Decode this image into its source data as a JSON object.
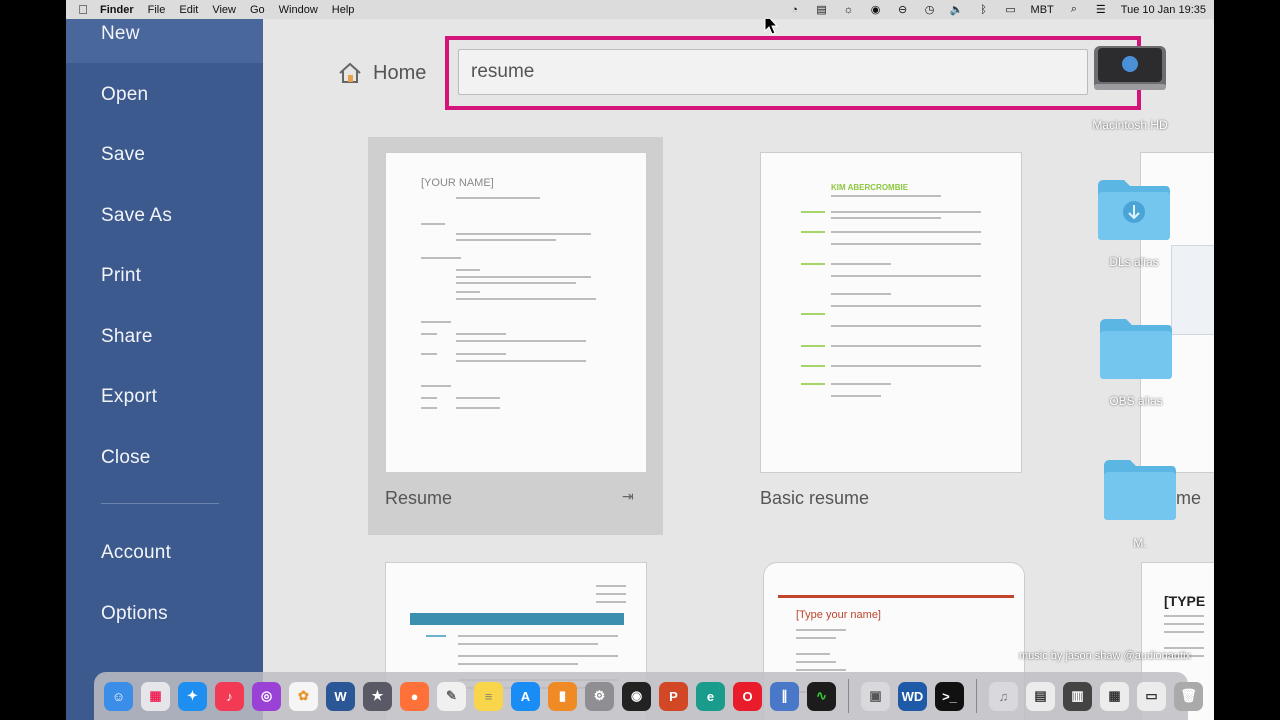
{
  "menubar": {
    "app": "Finder",
    "items": [
      "File",
      "Edit",
      "View",
      "Go",
      "Window",
      "Help"
    ],
    "status": "MBT",
    "datetime": "Tue 10 Jan  19:35"
  },
  "sidebar": {
    "items": [
      "New",
      "Open",
      "Save",
      "Save As",
      "Print",
      "Share",
      "Export",
      "Close"
    ],
    "bottom_items": [
      "Account",
      "Options"
    ]
  },
  "main": {
    "home_label": "Home",
    "search_value": "resume",
    "templates": [
      {
        "label": "Resume",
        "doc_name": "[YOUR NAME]"
      },
      {
        "label": "Basic resume",
        "doc_name": "KIM ABERCROMBIE"
      },
      {
        "label": "me",
        "doc_name": ""
      },
      {
        "label": "",
        "doc_name": ""
      },
      {
        "label": "",
        "doc_name": "[Type your name]"
      },
      {
        "label": "",
        "doc_name": "[TYPE"
      }
    ]
  },
  "desktop": {
    "drive": "Macintosh HD",
    "folders": [
      "DLs alias",
      "OBS alias",
      "M."
    ]
  },
  "watermark": "music by jason shaw @audionautix",
  "colors": {
    "sidebar": "#3d5a8f",
    "highlight": "#d4147a",
    "folder": "#5bb6e4"
  }
}
